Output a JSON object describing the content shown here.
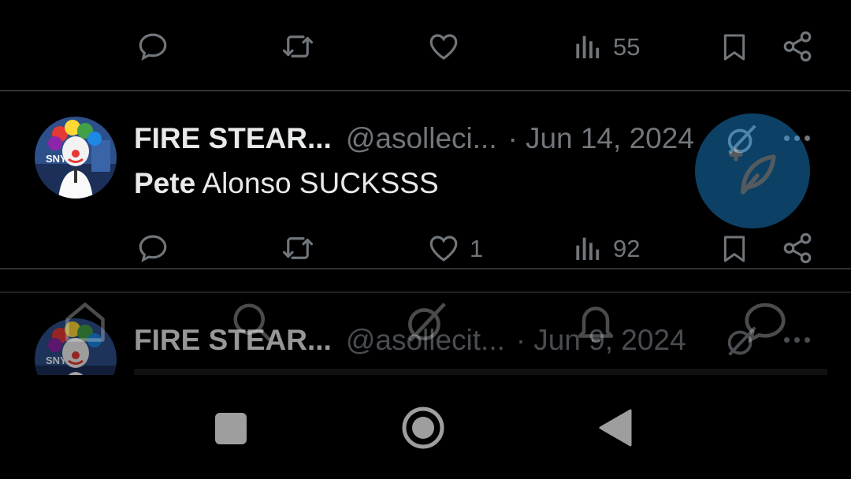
{
  "top_actions": {
    "views_count": "55"
  },
  "tweet1": {
    "display_name": "FIRE STEAR...",
    "handle": "@asolleci...",
    "separator": "·",
    "date": "Jun 14, 2024",
    "text_bold": "Pete",
    "text_rest": " Alonso SUCKSSS",
    "actions": {
      "likes_count": "1",
      "views_count": "92"
    }
  },
  "tweet2": {
    "display_name": "FIRE STEAR...",
    "handle": "@asollecit...",
    "separator": "·",
    "date": "Jun 9, 2024"
  },
  "icons": {
    "reply": "reply-icon",
    "retweet": "retweet-icon",
    "like": "heart-icon",
    "views": "views-icon",
    "bookmark": "bookmark-icon",
    "share": "share-icon",
    "compose": "compose-icon",
    "more": "more-icon",
    "grok": "grok-icon",
    "home": "home-icon",
    "search": "search-icon",
    "notifications": "bell-icon",
    "messages": "messages-icon",
    "recents": "square-icon",
    "nav_home": "circle-icon",
    "back": "triangle-icon"
  },
  "colors": {
    "background": "#000000",
    "text": "#e7e9ea",
    "muted": "#71767b",
    "accent": "#1d9bf0",
    "divider": "#2f3336"
  }
}
